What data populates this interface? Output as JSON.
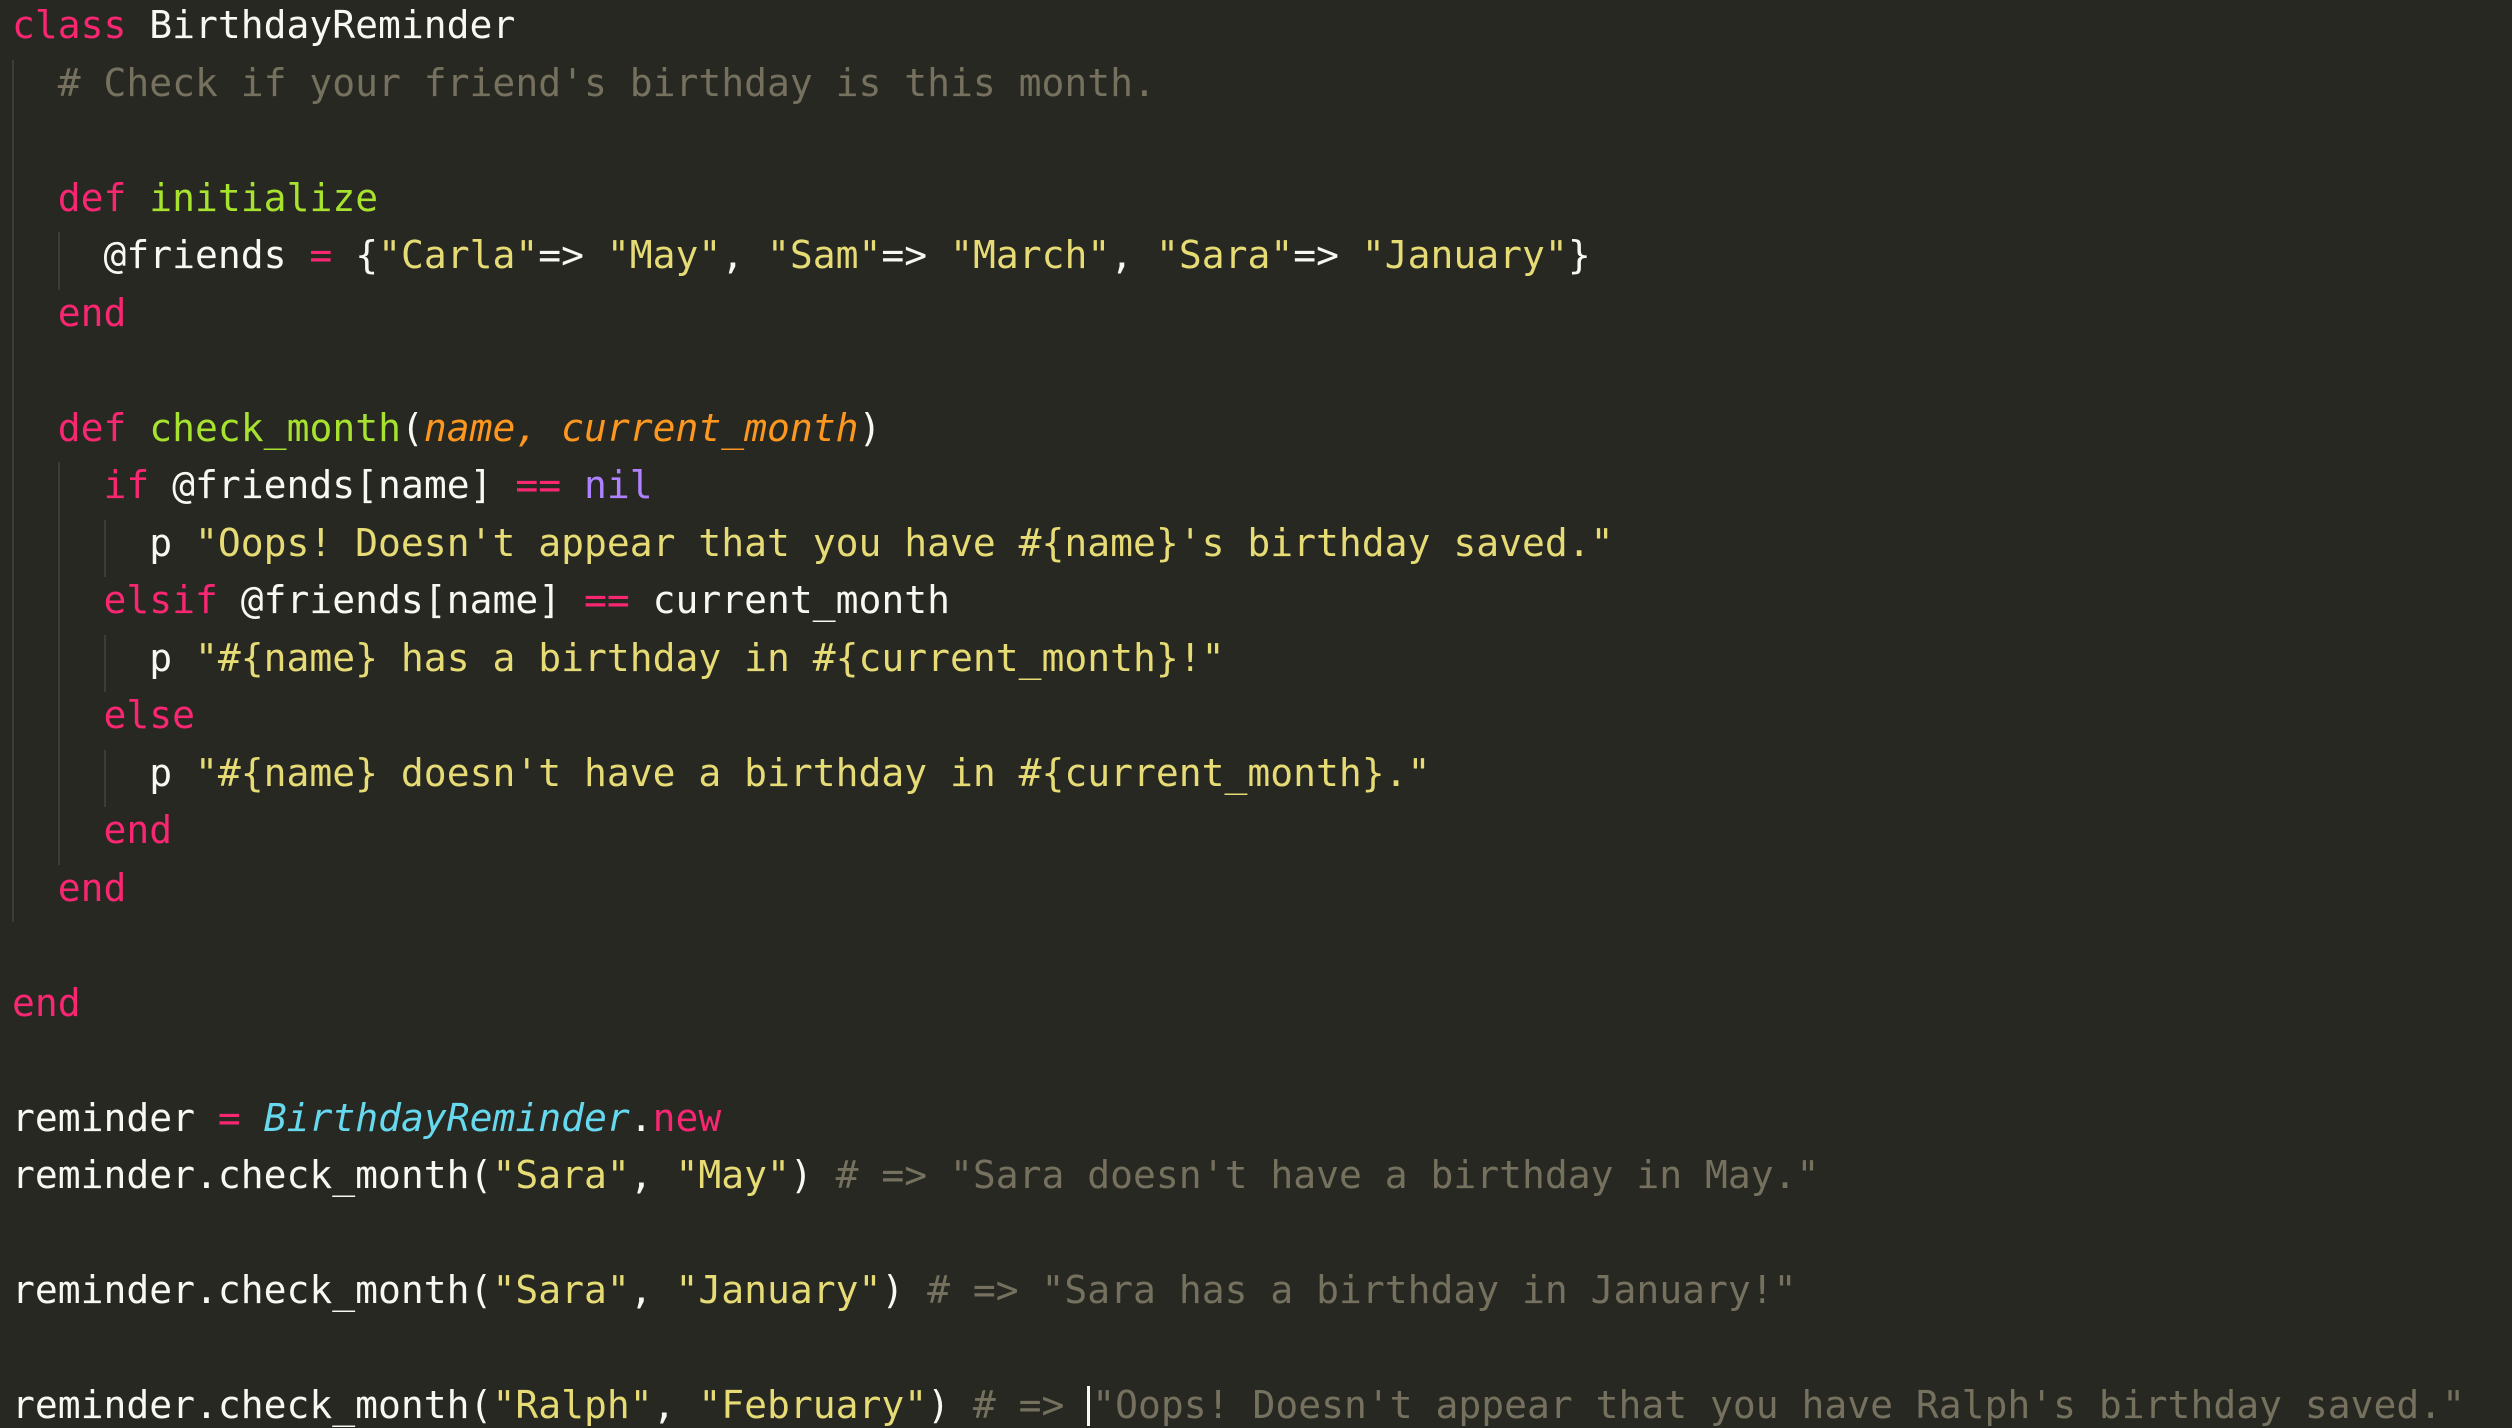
{
  "theme": {
    "background": "#272822",
    "foreground": "#f8f8f2",
    "keyword": "#f92672",
    "function": "#a6e22e",
    "string": "#e6db74",
    "comment": "#75715e",
    "parameter": "#fd971f",
    "constant": "#ae81ff",
    "class_name": "#66d9ef",
    "indent_guide": "#3e3d32",
    "cursor": "#f8f8f0"
  },
  "code": {
    "lines": [
      [
        {
          "t": "class",
          "c": "kw"
        },
        {
          "t": " BirthdayReminder",
          "c": "plain"
        }
      ],
      [
        {
          "t": "  # Check if your friend's birthday is this month.",
          "c": "comment"
        }
      ],
      [],
      [
        {
          "t": "  ",
          "c": "plain"
        },
        {
          "t": "def",
          "c": "kw"
        },
        {
          "t": " ",
          "c": "plain"
        },
        {
          "t": "initialize",
          "c": "fn"
        }
      ],
      [
        {
          "t": "    @friends ",
          "c": "plain"
        },
        {
          "t": "=",
          "c": "kw"
        },
        {
          "t": " {",
          "c": "plain"
        },
        {
          "t": "\"Carla\"",
          "c": "str"
        },
        {
          "t": "=> ",
          "c": "plain"
        },
        {
          "t": "\"May\"",
          "c": "str"
        },
        {
          "t": ", ",
          "c": "plain"
        },
        {
          "t": "\"Sam\"",
          "c": "str"
        },
        {
          "t": "=> ",
          "c": "plain"
        },
        {
          "t": "\"March\"",
          "c": "str"
        },
        {
          "t": ", ",
          "c": "plain"
        },
        {
          "t": "\"Sara\"",
          "c": "str"
        },
        {
          "t": "=> ",
          "c": "plain"
        },
        {
          "t": "\"January\"",
          "c": "str"
        },
        {
          "t": "}",
          "c": "plain"
        }
      ],
      [
        {
          "t": "  ",
          "c": "plain"
        },
        {
          "t": "end",
          "c": "kw"
        }
      ],
      [],
      [
        {
          "t": "  ",
          "c": "plain"
        },
        {
          "t": "def",
          "c": "kw"
        },
        {
          "t": " ",
          "c": "plain"
        },
        {
          "t": "check_month",
          "c": "fn"
        },
        {
          "t": "(",
          "c": "plain"
        },
        {
          "t": "name, current_month",
          "c": "param"
        },
        {
          "t": ")",
          "c": "plain"
        }
      ],
      [
        {
          "t": "    ",
          "c": "plain"
        },
        {
          "t": "if",
          "c": "kw"
        },
        {
          "t": " @friends[name] ",
          "c": "plain"
        },
        {
          "t": "==",
          "c": "kw"
        },
        {
          "t": " ",
          "c": "plain"
        },
        {
          "t": "nil",
          "c": "const"
        }
      ],
      [
        {
          "t": "      p ",
          "c": "plain"
        },
        {
          "t": "\"Oops! Doesn't appear that you have #{name}'s birthday saved.\"",
          "c": "str"
        }
      ],
      [
        {
          "t": "    ",
          "c": "plain"
        },
        {
          "t": "elsif",
          "c": "kw"
        },
        {
          "t": " @friends[name] ",
          "c": "plain"
        },
        {
          "t": "==",
          "c": "kw"
        },
        {
          "t": " current_month",
          "c": "plain"
        }
      ],
      [
        {
          "t": "      p ",
          "c": "plain"
        },
        {
          "t": "\"#{name} has a birthday in #{current_month}!\"",
          "c": "str"
        }
      ],
      [
        {
          "t": "    ",
          "c": "plain"
        },
        {
          "t": "else",
          "c": "kw"
        }
      ],
      [
        {
          "t": "      p ",
          "c": "plain"
        },
        {
          "t": "\"#{name} doesn't have a birthday in #{current_month}.\"",
          "c": "str"
        }
      ],
      [
        {
          "t": "    ",
          "c": "plain"
        },
        {
          "t": "end",
          "c": "kw"
        }
      ],
      [
        {
          "t": "  ",
          "c": "plain"
        },
        {
          "t": "end",
          "c": "kw"
        }
      ],
      [],
      [
        {
          "t": "end",
          "c": "kw"
        }
      ],
      [],
      [
        {
          "t": "reminder ",
          "c": "plain"
        },
        {
          "t": "=",
          "c": "kw"
        },
        {
          "t": " ",
          "c": "plain"
        },
        {
          "t": "BirthdayReminder",
          "c": "cls"
        },
        {
          "t": ".",
          "c": "plain"
        },
        {
          "t": "new",
          "c": "kw"
        }
      ],
      [
        {
          "t": "reminder.check_month(",
          "c": "plain"
        },
        {
          "t": "\"Sara\"",
          "c": "str"
        },
        {
          "t": ", ",
          "c": "plain"
        },
        {
          "t": "\"May\"",
          "c": "str"
        },
        {
          "t": ") ",
          "c": "plain"
        },
        {
          "t": "# => \"Sara doesn't have a birthday in May.\"",
          "c": "comment"
        }
      ],
      [],
      [
        {
          "t": "reminder.check_month(",
          "c": "plain"
        },
        {
          "t": "\"Sara\"",
          "c": "str"
        },
        {
          "t": ", ",
          "c": "plain"
        },
        {
          "t": "\"January\"",
          "c": "str"
        },
        {
          "t": ") ",
          "c": "plain"
        },
        {
          "t": "# => \"Sara has a birthday in January!\"",
          "c": "comment"
        }
      ],
      [],
      [
        {
          "t": "reminder.check_month(",
          "c": "plain"
        },
        {
          "t": "\"Ralph\"",
          "c": "str"
        },
        {
          "t": ", ",
          "c": "plain"
        },
        {
          "t": "\"February\"",
          "c": "str"
        },
        {
          "t": ") ",
          "c": "plain"
        },
        {
          "t": "# => ",
          "c": "comment"
        },
        {
          "cursor": true
        },
        {
          "t": "\"Oops! Doesn't appear that you have Ralph's birthday saved.\"",
          "c": "comment"
        }
      ]
    ]
  }
}
